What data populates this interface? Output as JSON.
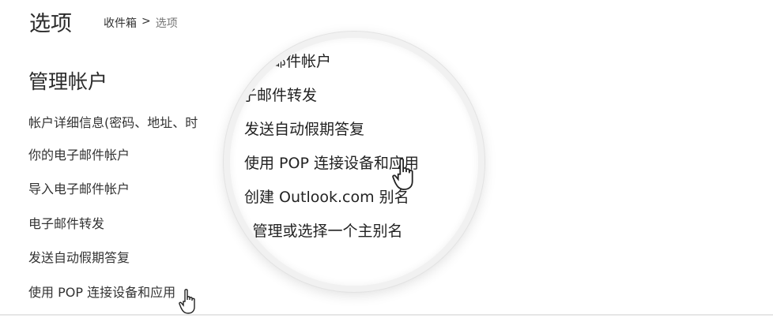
{
  "header": {
    "title": "选项",
    "breadcrumb": {
      "parent": "收件箱",
      "separator": ">",
      "current": "选项"
    }
  },
  "section": {
    "title": "管理帐户",
    "items": [
      "帐户详细信息(密码、地址、时",
      "你的电子邮件帐户",
      "导入电子邮件帐户",
      "电子邮件转发",
      "发送自动假期答复",
      "使用 POP 连接设备和应用"
    ]
  },
  "magnifier": {
    "items": [
      "电子邮件帐户",
      "电子邮件转发",
      "发送自动假期答复",
      "使用 POP 连接设备和应用",
      "创建 Outlook.com 别名",
      "别名: 管理或选择一个主别名"
    ]
  },
  "cursor_icon": "hand-pointer-icon"
}
